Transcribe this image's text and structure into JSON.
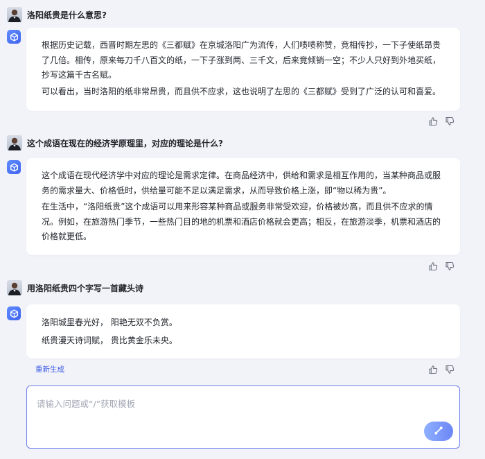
{
  "conversation": [
    {
      "question": "洛阳纸贵是什么意思?",
      "answer": [
        "根据历史记载，西晋时期左思的《三都赋》在京城洛阳广为流传，人们啧啧称赞，竞相传抄，一下子使纸昂贵了几倍。相传，原来每刀千八百文的纸，一下子涨到两、三千文，后来竟倾销一空；不少人只好到外地买纸，抄写这篇千古名赋。",
        "可以看出，当时洛阳的纸非常昂贵，而且供不应求，这也说明了左思的《三都赋》受到了广泛的认可和喜爱。"
      ]
    },
    {
      "question": "这个成语在现在的经济学原理里，对应的理论是什么?",
      "answer": [
        "这个成语在现代经济学中对应的理论是需求定律。在商品经济中，供给和需求是相互作用的，当某种商品或服务的需求量大、价格低时，供给量可能不足以满足需求，从而导致价格上涨，即“物以稀为贵”。",
        "在生活中，“洛阳纸贵”这个成语可以用来形容某种商品或服务非常受欢迎，价格被炒高，而且供不应求的情况。例如，在旅游热门季节，一些热门目的地的机票和酒店价格就会更高；相反，在旅游淡季，机票和酒店的价格就更低。"
      ]
    },
    {
      "question": "用洛阳纸贵四个字写一首藏头诗",
      "answer": [
        "洛阳城里春光好，  阳艳无双不负赏。",
        "纸贵漫天诗词赋，  贵比黄金乐未央。"
      ]
    }
  ],
  "regenerate_label": "重新生成",
  "input": {
    "placeholder": "请输入问题或“/”获取模板",
    "value": ""
  },
  "icons": {
    "bot": "bot-cube-icon",
    "like": "thumbs-up-icon",
    "dislike": "thumbs-down-icon",
    "send": "send-icon"
  },
  "colors": {
    "accent": "#3d5ce6",
    "input_border": "#6c7ff0",
    "background": "#f2f3f8",
    "card": "#ffffff"
  }
}
